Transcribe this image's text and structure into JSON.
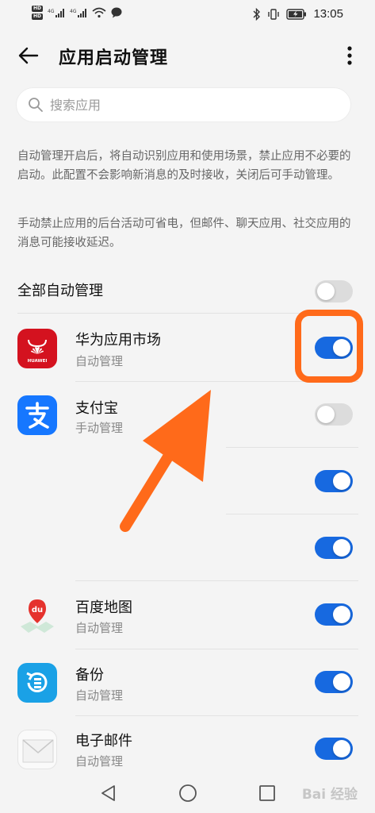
{
  "status_bar": {
    "hd1": "HD",
    "hd2": "HD",
    "signal1": "4G",
    "signal2": "4G",
    "time": "13:05"
  },
  "header": {
    "title": "应用启动管理"
  },
  "search": {
    "placeholder": "搜索应用"
  },
  "descriptions": {
    "para1": "自动管理开启后，将自动识别应用和使用场景，禁止应用不必要的启动。此配置不会影响新消息的及时接收，关闭后可手动管理。",
    "para2": "手动禁止应用的后台活动可省电，但邮件、聊天应用、社交应用的消息可能接收延迟。"
  },
  "all_auto": {
    "label": "全部自动管理",
    "enabled": false
  },
  "apps": [
    {
      "name": "华为应用市场",
      "mode": "自动管理",
      "icon": "huawei-appgallery-icon",
      "icon_text": "HUAWEI",
      "enabled": true
    },
    {
      "name": "支付宝",
      "mode": "手动管理",
      "icon": "alipay-icon",
      "icon_text": "支",
      "enabled": false
    },
    {
      "name": "",
      "mode": "",
      "icon": "",
      "enabled": true
    },
    {
      "name": "",
      "mode": "",
      "icon": "",
      "enabled": true
    },
    {
      "name": "百度地图",
      "mode": "自动管理",
      "icon": "baidu-map-icon",
      "icon_text": "du",
      "enabled": true
    },
    {
      "name": "备份",
      "mode": "自动管理",
      "icon": "backup-icon",
      "enabled": true
    },
    {
      "name": "电子邮件",
      "mode": "自动管理",
      "icon": "email-icon",
      "enabled": true
    }
  ],
  "watermark": "Bai 经验",
  "colors": {
    "accent": "#1769e0",
    "annotation": "#ff6a1a",
    "huawei_red": "#d4121f",
    "alipay_blue": "#1677ff",
    "baidu_red": "#e5322d"
  }
}
